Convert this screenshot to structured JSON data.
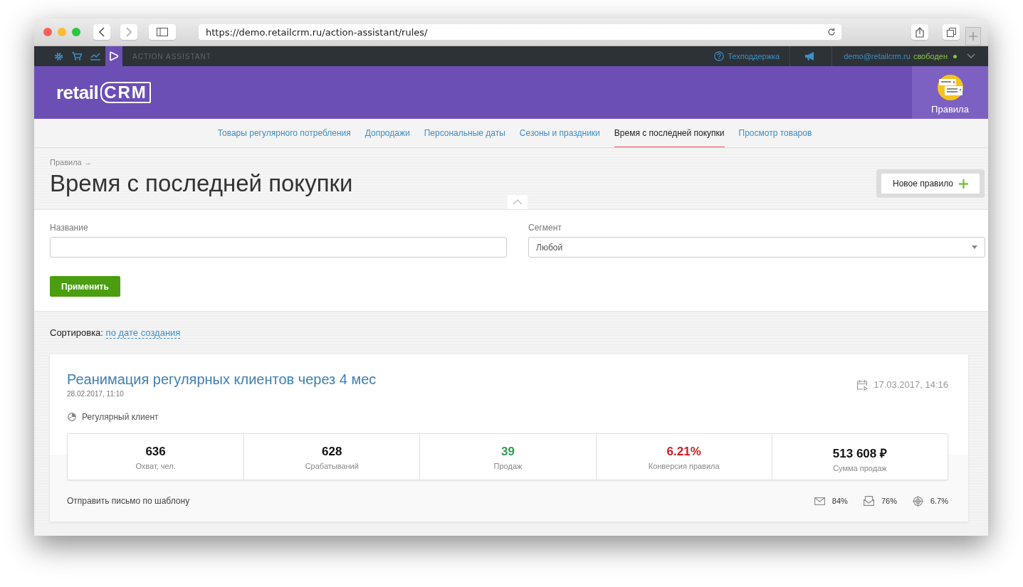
{
  "browser": {
    "url": "https://demo.retailcrm.ru/action-assistant/rules/"
  },
  "topbar": {
    "apps": [
      {
        "kind": "gear",
        "selected": false
      },
      {
        "kind": "cart",
        "selected": false
      },
      {
        "kind": "chart",
        "selected": false
      },
      {
        "kind": "play",
        "selected": true
      }
    ],
    "section": "ACTION ASSISTANT",
    "support": "Техподдержка",
    "user": "demo@retailcrm.ru",
    "status": "свободен",
    "online": true
  },
  "header": {
    "logo": {
      "prefix": "retail",
      "suffix": "CRM"
    },
    "module": "Правила"
  },
  "tabs": [
    {
      "label": "Товары регулярного потребления",
      "selected": false
    },
    {
      "label": "Допродажи",
      "selected": false
    },
    {
      "label": "Персональные даты",
      "selected": false
    },
    {
      "label": "Сезоны и праздники",
      "selected": false
    },
    {
      "label": "Время с последней покупки",
      "selected": true
    },
    {
      "label": "Просмотр товаров",
      "selected": false
    }
  ],
  "breadcrumb": "Правила →",
  "title": "Время с последней покупки",
  "new_button": "Новое правило",
  "filters": {
    "name": {
      "label": "Название"
    },
    "segment": {
      "label": "Сегмент",
      "value": "Любой"
    },
    "apply": "Применить"
  },
  "sort": {
    "label": "Сортировка:",
    "value": "по дате создания"
  },
  "rules": [
    {
      "title": "Реанимация регулярных клиентов через 4 мес",
      "created": "28.02.2017, 11:10",
      "launched": "17.03.2017, 14:16",
      "segment": "Регулярный клиент",
      "stats": [
        {
          "value": "636",
          "label": "Охват, чел.",
          "color": "#111111"
        },
        {
          "value": "628",
          "label": "Срабатываний",
          "color": "#111111"
        },
        {
          "value": "39",
          "label": "Продаж",
          "color": "#2e9e4f"
        },
        {
          "value": "6.21%",
          "label": "Конверсия правила",
          "color": "#cc1f1f"
        },
        {
          "value": "513 608 ₽",
          "label": "Сумма продаж",
          "color": "#111111"
        }
      ],
      "action": "Отправить письмо по шаблону",
      "metrics": [
        {
          "kind": "sent",
          "value": "84%"
        },
        {
          "kind": "opened",
          "value": "76%"
        },
        {
          "kind": "goal",
          "value": "6.7%"
        }
      ]
    }
  ]
}
